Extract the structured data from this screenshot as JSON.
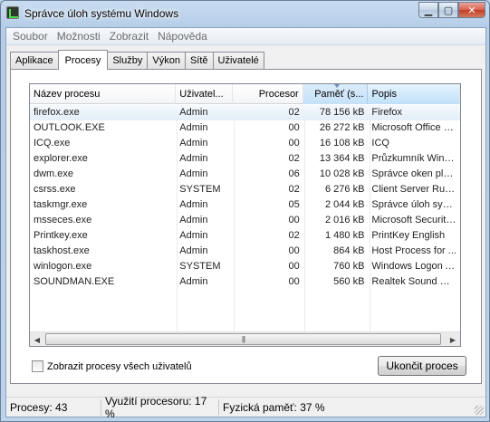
{
  "window": {
    "title": "Správce úloh systému Windows",
    "controls": {
      "minimize": "▁",
      "maximize": "▢",
      "close": "✕"
    }
  },
  "menu": [
    "Soubor",
    "Možnosti",
    "Zobrazit",
    "Nápověda"
  ],
  "tabs": [
    "Aplikace",
    "Procesy",
    "Služby",
    "Výkon",
    "Sítě",
    "Uživatelé"
  ],
  "active_tab": "Procesy",
  "columns": {
    "name": "Název procesu",
    "user": "Uživatel...",
    "cpu": "Procesor",
    "mem": "Paměť (s...",
    "desc": "Popis"
  },
  "processes": [
    {
      "name": "firefox.exe",
      "user": "Admin",
      "cpu": "02",
      "mem": "78 156 kB",
      "desc": "Firefox"
    },
    {
      "name": "OUTLOOK.EXE",
      "user": "Admin",
      "cpu": "00",
      "mem": "26 272 kB",
      "desc": "Microsoft Office O..."
    },
    {
      "name": "ICQ.exe",
      "user": "Admin",
      "cpu": "00",
      "mem": "16 108 kB",
      "desc": "ICQ"
    },
    {
      "name": "explorer.exe",
      "user": "Admin",
      "cpu": "02",
      "mem": "13 364 kB",
      "desc": "Průzkumník Windows"
    },
    {
      "name": "dwm.exe",
      "user": "Admin",
      "cpu": "06",
      "mem": "10 028 kB",
      "desc": "Správce oken plochy"
    },
    {
      "name": "csrss.exe",
      "user": "SYSTEM",
      "cpu": "02",
      "mem": "6 276 kB",
      "desc": "Client Server Runti..."
    },
    {
      "name": "taskmgr.exe",
      "user": "Admin",
      "cpu": "05",
      "mem": "2 044 kB",
      "desc": "Správce úloh systé..."
    },
    {
      "name": "msseces.exe",
      "user": "Admin",
      "cpu": "00",
      "mem": "2 016 kB",
      "desc": "Microsoft Security ..."
    },
    {
      "name": "Printkey.exe",
      "user": "Admin",
      "cpu": "02",
      "mem": "1 480 kB",
      "desc": "PrintKey English"
    },
    {
      "name": "taskhost.exe",
      "user": "Admin",
      "cpu": "00",
      "mem": "864 kB",
      "desc": "Host Process for ..."
    },
    {
      "name": "winlogon.exe",
      "user": "SYSTEM",
      "cpu": "00",
      "mem": "760 kB",
      "desc": "Windows Logon Ap..."
    },
    {
      "name": "SOUNDMAN.EXE",
      "user": "Admin",
      "cpu": "00",
      "mem": "560 kB",
      "desc": "Realtek Sound Ma..."
    }
  ],
  "scrollbar": {
    "left": "◀",
    "right": "▶",
    "grip": "|||"
  },
  "show_all_users_label": "Zobrazit procesy všech uživatelů",
  "end_process_label": "Ukončit proces",
  "status": {
    "processes": "Procesy: 43",
    "cpu": "Využití procesoru: 17 %",
    "memory": "Fyzická paměť: 37 %"
  }
}
